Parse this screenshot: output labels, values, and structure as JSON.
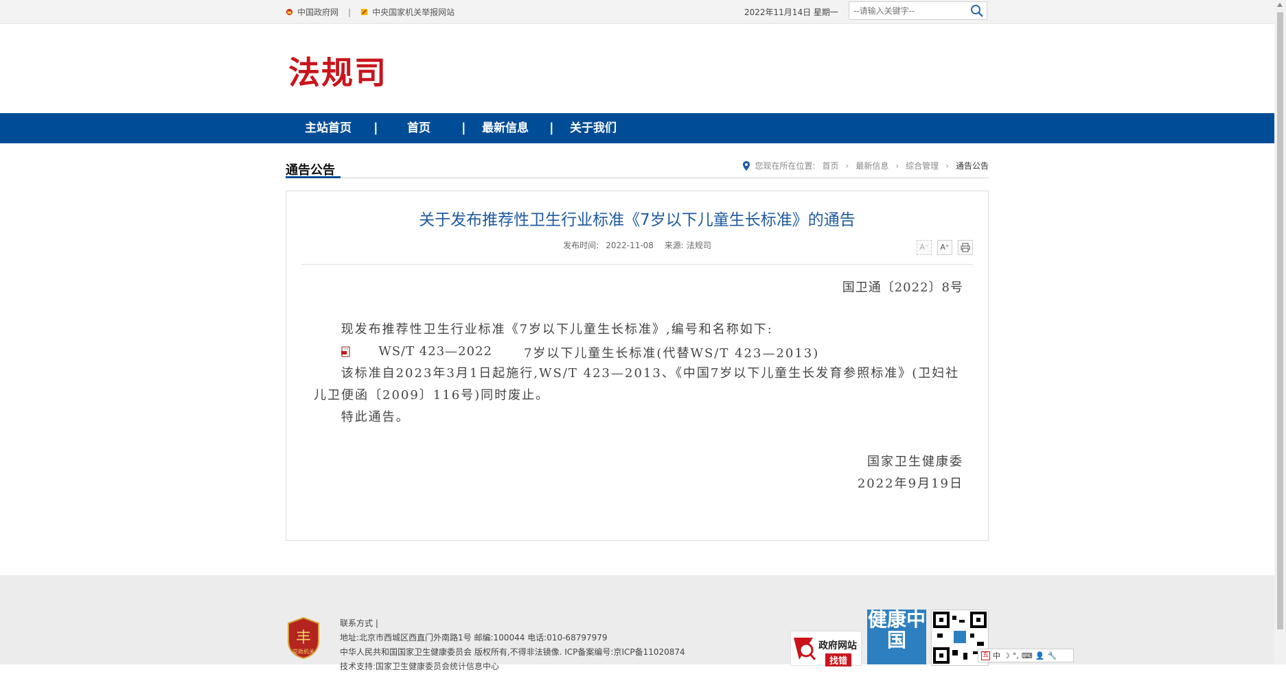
{
  "topbar": {
    "link1": "中国政府网",
    "separator": "|",
    "link2": "中央国家机关举报网站",
    "date": "2022年11月14日 星期一",
    "search_placeholder": "--请输入关键字--"
  },
  "logo": {
    "text": "法规司"
  },
  "nav": {
    "items": [
      "主站首页",
      "首页",
      "最新信息",
      "关于我们"
    ],
    "separator": "|"
  },
  "section": {
    "title": "通告公告",
    "breadcrumb_prefix": "您现在所在位置:",
    "breadcrumb": [
      "首页",
      "最新信息",
      "综合管理",
      "通告公告"
    ]
  },
  "article": {
    "title": "关于发布推荐性卫生行业标准《7岁以下儿童生长标准》的通告",
    "publish_label": "发布时间:",
    "publish_date": "2022-11-08",
    "source_label": "来源:",
    "source": "法规司",
    "tools": {
      "font_smaller": "A⁻",
      "font_larger": "A⁺"
    },
    "doc_number": "国卫通〔2022〕8号",
    "para1": "现发布推荐性卫生行业标准《7岁以下儿童生长标准》,编号和名称如下:",
    "std_code": "WS/T 423—2022",
    "std_name": "7岁以下儿童生长标准(代替WS/T 423—2013)",
    "para2": "该标准自2023年3月1日起施行,WS/T 423—2013、《中国7岁以下儿童生长发育参照标准》(卫妇社儿卫便函〔2009〕116号)同时废止。",
    "para3": "特此通告。",
    "sign_org": "国家卫生健康委",
    "sign_date": "2022年9月19日"
  },
  "footer": {
    "contact": "联系方式 |",
    "address": "地址:北京市西城区西直门外南路1号    邮编:100044    电话:010-68797979",
    "copyright": "中华人民共和国国家卫生健康委员会    版权所有,不得非法镜像.    ICP备案编号:京ICP备11020874",
    "tech": "技术支持:国家卫生健康委员会统计信息中心",
    "badge_label": "政府网站",
    "badge_sub": "找错",
    "health_china": "健康中国"
  },
  "ime": {
    "items": [
      "中",
      "☽",
      "°,",
      "⌨",
      "👤",
      "🔧"
    ]
  },
  "colors": {
    "nav_blue": "#004c96",
    "logo_red": "#c9141b",
    "title_blue": "#1e5aa0"
  }
}
